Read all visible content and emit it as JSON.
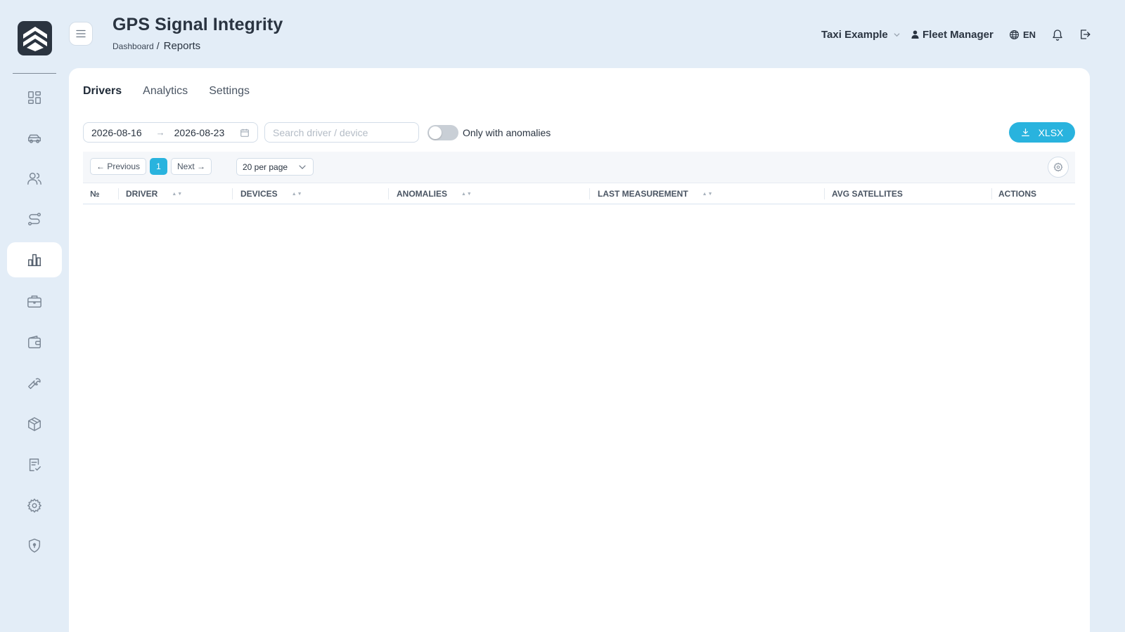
{
  "header": {
    "title": "GPS Signal Integrity",
    "breadcrumb": {
      "root": "Dashboard",
      "separator": "/",
      "current": "Reports"
    },
    "company": "Taxi Example",
    "user": "Fleet Manager",
    "language": "EN"
  },
  "sidebar": {
    "logo": "logo-chevrons-icon",
    "items": [
      {
        "icon": "dashboard-grid-icon",
        "active": false
      },
      {
        "icon": "car-icon",
        "active": false
      },
      {
        "icon": "users-icon",
        "active": false
      },
      {
        "icon": "route-icon",
        "active": false
      },
      {
        "icon": "bar-chart-icon",
        "active": true
      },
      {
        "icon": "briefcase-icon",
        "active": false
      },
      {
        "icon": "wallet-icon",
        "active": false
      },
      {
        "icon": "wrench-icon",
        "active": false
      },
      {
        "icon": "package-icon",
        "active": false
      },
      {
        "icon": "checklist-icon",
        "active": false
      },
      {
        "icon": "gear-icon",
        "active": false
      },
      {
        "icon": "shield-icon",
        "active": false
      }
    ]
  },
  "tabs": [
    {
      "label": "Drivers",
      "active": true
    },
    {
      "label": "Analytics",
      "active": false
    },
    {
      "label": "Settings",
      "active": false
    }
  ],
  "filters": {
    "date_from": "2026-08-16",
    "date_to": "2026-08-23",
    "search_placeholder": "Search driver / device",
    "search_value": "",
    "anomalies_toggle_label": "Only with anomalies",
    "anomalies_only": false,
    "export_label": "XLSX"
  },
  "pagination": {
    "previous_label": "← Previous",
    "current_page": "1",
    "next_label": "Next →",
    "per_page": "20 per page"
  },
  "table": {
    "columns": [
      "№",
      "DRIVER",
      "DEVICES",
      "ANOMALIES",
      "LAST MEASUREMENT",
      "AVG SATELLITES",
      "ACTIONS"
    ],
    "sortable": [
      false,
      true,
      true,
      true,
      true,
      false,
      false
    ],
    "rows": []
  },
  "colors": {
    "accent": "#29b3de",
    "background": "#e3edf7",
    "logo_bg": "#2b3440",
    "text_primary": "#2a3441"
  }
}
